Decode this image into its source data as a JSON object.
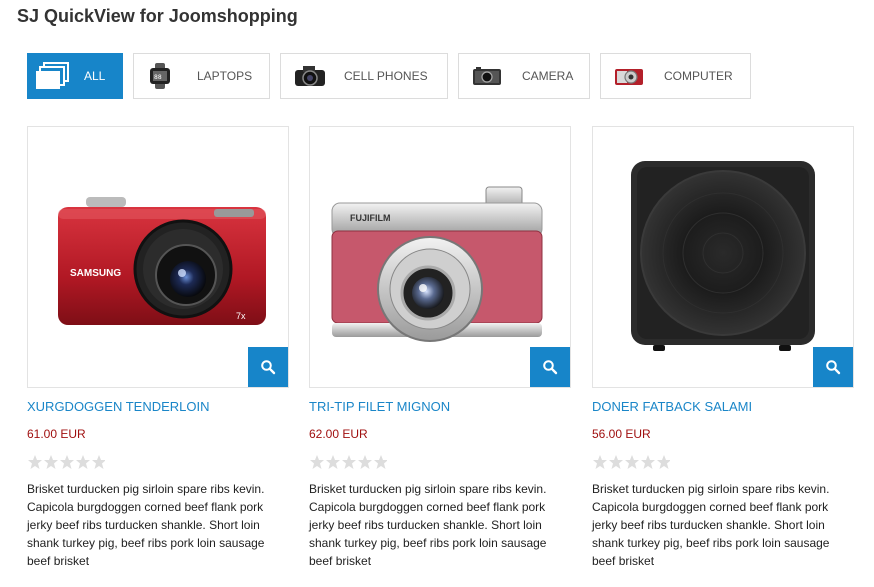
{
  "module": {
    "title": "SJ QuickView for Joomshopping"
  },
  "tabs": [
    {
      "label": "ALL",
      "icon": "stack-icon",
      "active": true
    },
    {
      "label": "LAPTOPS",
      "icon": "watch-thumbnail-icon",
      "active": false
    },
    {
      "label": "CELL PHONES",
      "icon": "dslr-camera-thumbnail-icon",
      "active": false
    },
    {
      "label": "CAMERA",
      "icon": "compact-camera-thumbnail-icon",
      "active": false
    },
    {
      "label": "COMPUTER",
      "icon": "red-camera-thumbnail-icon",
      "active": false
    }
  ],
  "products": [
    {
      "name": "XURGDOGGEN TENDERLOIN",
      "price": "61.00 EUR",
      "rating": 0,
      "image": "red-samsung-camera",
      "camera_brand": "SAMSUNG",
      "description": "Brisket turducken pig sirloin spare ribs kevin. Capicola burgdoggen corned beef flank pork jerky beef ribs turducken shankle. Short loin shank turkey pig, beef ribs pork loin sausage beef brisket"
    },
    {
      "name": "TRI-TIP FILET MIGNON",
      "price": "62.00 EUR",
      "rating": 0,
      "image": "pink-fujifilm-camera",
      "camera_brand": "FUJIFILM",
      "description": "Brisket turducken pig sirloin spare ribs kevin. Capicola burgdoggen corned beef flank pork jerky beef ribs turducken shankle. Short loin shank turkey pig, beef ribs pork loin sausage beef brisket"
    },
    {
      "name": "DONER FATBACK SALAMI",
      "price": "56.00 EUR",
      "rating": 0,
      "image": "black-subwoofer",
      "description": "Brisket turducken pig sirloin spare ribs kevin. Capicola burgdoggen corned beef flank pork jerky beef ribs turducken shankle. Short loin shank turkey pig, beef ribs pork loin sausage beef brisket"
    }
  ],
  "colors": {
    "accent": "#1785c9",
    "link": "#1a86c8",
    "price": "#a01010",
    "star_empty": "#dddddd"
  }
}
